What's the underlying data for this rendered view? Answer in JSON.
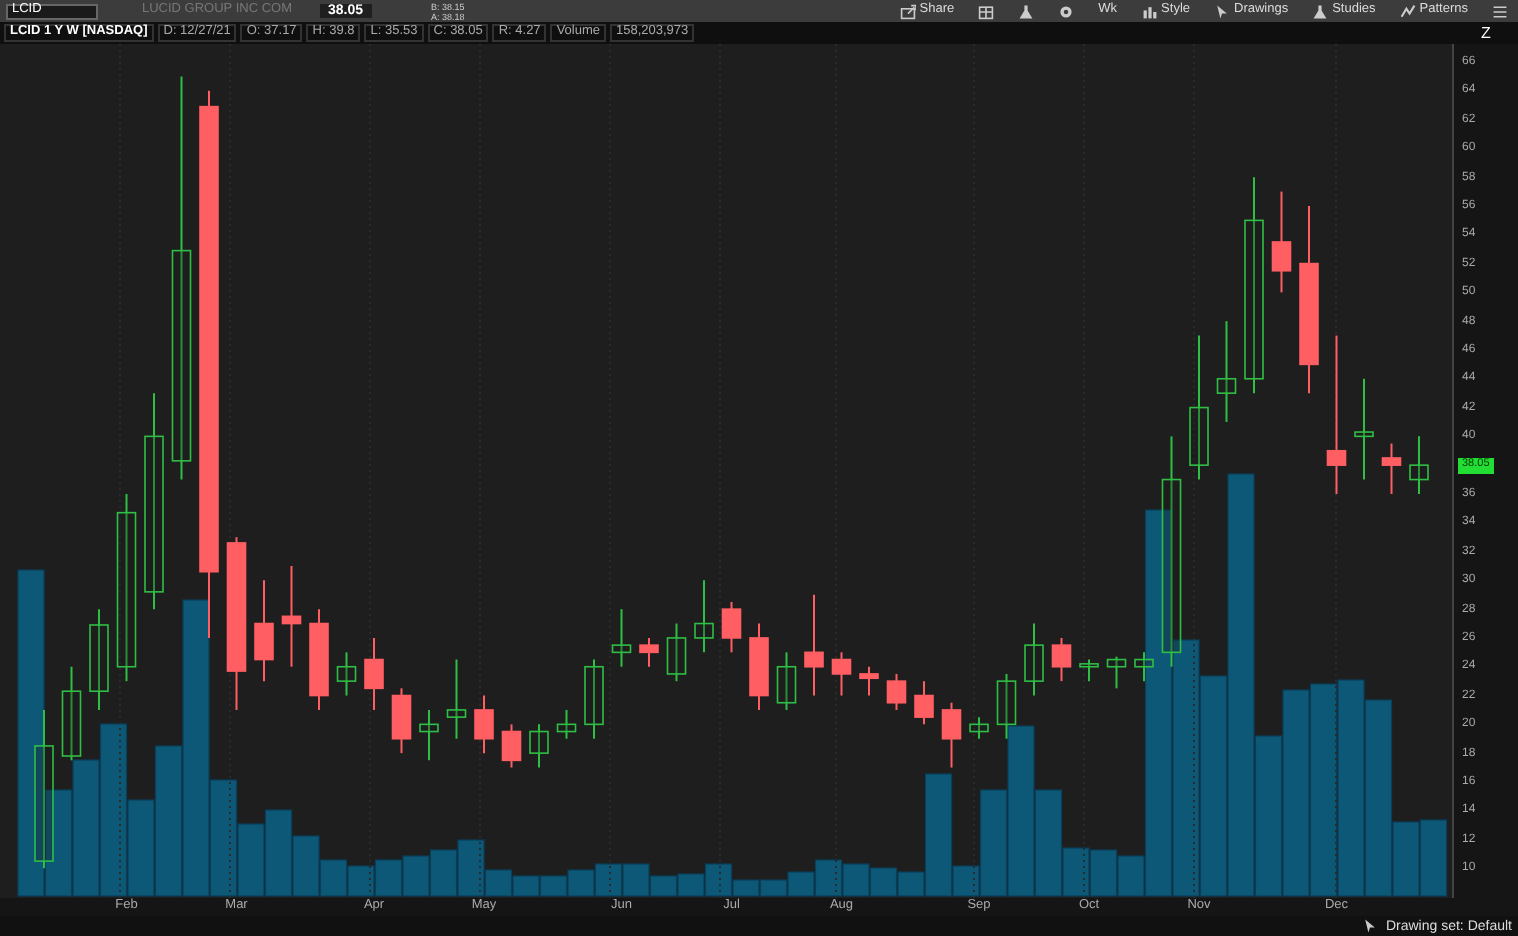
{
  "toolbar": {
    "symbol": "LCID",
    "company": "LUCID GROUP INC COM",
    "last": "38.05",
    "bid": "B: 38.15",
    "ask": "A: 38.18",
    "buttons": [
      {
        "label": "Share",
        "kind": "share"
      },
      {
        "kind": "grid"
      },
      {
        "kind": "flask"
      },
      {
        "kind": "gear"
      },
      {
        "label": "Wk",
        "kind": "text"
      },
      {
        "label": "Style",
        "kind": "style"
      },
      {
        "label": "Drawings",
        "kind": "cursor"
      },
      {
        "label": "Studies",
        "kind": "flask"
      },
      {
        "label": "Patterns",
        "kind": "patterns"
      },
      {
        "kind": "menu"
      }
    ]
  },
  "info_bar": [
    "LCID 1 Y W [NASDAQ]",
    "D: 12/27/21",
    "O: 37.17",
    "H: 39.8",
    "L: 35.53",
    "C: 38.05",
    "R: 4.27",
    "Volume",
    "158,203,973"
  ],
  "chart": {
    "price_badge": "38.05",
    "zoom_label": "Z",
    "chart_data": {
      "type": "candlestick",
      "categories": [
        null,
        null,
        null,
        "Feb",
        null,
        null,
        null,
        "Mar",
        null,
        null,
        null,
        null,
        "Apr",
        null,
        null,
        null,
        "May",
        null,
        null,
        null,
        null,
        "Jun",
        null,
        null,
        null,
        "Jul",
        null,
        null,
        null,
        "Aug",
        null,
        null,
        null,
        null,
        "Sep",
        null,
        null,
        null,
        "Oct",
        null,
        null,
        null,
        "Nov",
        null,
        null,
        null,
        null,
        "Dec",
        null,
        null,
        null
      ],
      "ohlc": [
        [
          10.5,
          21,
          10,
          18.5
        ],
        [
          17.8,
          24,
          17.5,
          22.3
        ],
        [
          22.3,
          28,
          21,
          26.9
        ],
        [
          24,
          36,
          23,
          34.7
        ],
        [
          29.2,
          43,
          28,
          40
        ],
        [
          38.3,
          65,
          37,
          52.9
        ],
        [
          62.9,
          64,
          26,
          30.6
        ],
        [
          32.6,
          33,
          21,
          23.7
        ],
        [
          27,
          30,
          23,
          24.5
        ],
        [
          27.5,
          31,
          24,
          27
        ],
        [
          27,
          28,
          21,
          22
        ],
        [
          23,
          25,
          22,
          24
        ],
        [
          24.5,
          26,
          21,
          22.5
        ],
        [
          22,
          22.5,
          18,
          19
        ],
        [
          19.5,
          21,
          17.5,
          20
        ],
        [
          20.5,
          24.5,
          19,
          21
        ],
        [
          21,
          22,
          18,
          19
        ],
        [
          19.5,
          20,
          17,
          17.5
        ],
        [
          18,
          20,
          17,
          19.5
        ],
        [
          19.5,
          21,
          19,
          20
        ],
        [
          20,
          24.5,
          19,
          24
        ],
        [
          25,
          28,
          24,
          25.5
        ],
        [
          25.5,
          26,
          24,
          25
        ],
        [
          23.5,
          27,
          23,
          26
        ],
        [
          26,
          30,
          25,
          27
        ],
        [
          28,
          28.5,
          25,
          26
        ],
        [
          26,
          27,
          21,
          22
        ],
        [
          21.5,
          25,
          21,
          24
        ],
        [
          25,
          29,
          22,
          24
        ],
        [
          24.5,
          25,
          22,
          23.5
        ],
        [
          23.5,
          24,
          22,
          23.2
        ],
        [
          23,
          23.5,
          21,
          21.5
        ],
        [
          22,
          23,
          20,
          20.5
        ],
        [
          21,
          21.5,
          17,
          19
        ],
        [
          19.5,
          20.5,
          19,
          20
        ],
        [
          20,
          23.5,
          19,
          23
        ],
        [
          23,
          27,
          22,
          25.5
        ],
        [
          25.5,
          26,
          23,
          24
        ],
        [
          24,
          24.5,
          23,
          24.2
        ],
        [
          24,
          24.7,
          22.5,
          24.5
        ],
        [
          24,
          25,
          23,
          24.5
        ],
        [
          25,
          40,
          24,
          37
        ],
        [
          38,
          47,
          37,
          42
        ],
        [
          43,
          48,
          41,
          44
        ],
        [
          44,
          58,
          43,
          55
        ],
        [
          53.5,
          57,
          50,
          51.5
        ],
        [
          52,
          56,
          43,
          45
        ],
        [
          39,
          47,
          36,
          38
        ],
        [
          40,
          44,
          37,
          40.3
        ],
        [
          38.5,
          39.5,
          36,
          38
        ],
        [
          37,
          40,
          36,
          38
        ]
      ],
      "ylim": [
        7.8,
        67.25
      ],
      "grid": true,
      "yticks": [
        66,
        64,
        62,
        60,
        58,
        56,
        54,
        52,
        50,
        48,
        46,
        44,
        42,
        40,
        36,
        34,
        32,
        30,
        28,
        26,
        24,
        22,
        20,
        18,
        16,
        14,
        12,
        10
      ]
    }
  },
  "status_bar": {
    "drawing_set": "Drawing set: Default"
  }
}
